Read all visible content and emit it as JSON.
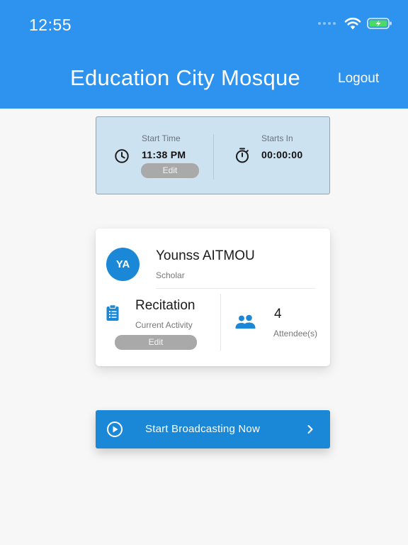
{
  "status_bar": {
    "time": "12:55"
  },
  "header": {
    "title": "Education City Mosque",
    "logout_label": "Logout"
  },
  "schedule": {
    "start_time_label": "Start Time",
    "start_time_value": "11:38 PM",
    "edit_label": "Edit",
    "starts_in_label": "Starts In",
    "starts_in_value": "00:00:00"
  },
  "scholar": {
    "initials": "YA",
    "name": "Younss AITMOU",
    "role": "Scholar",
    "activity_name": "Recitation",
    "activity_label": "Current Activity",
    "edit_label": "Edit",
    "attendee_count": "4",
    "attendee_label": "Attendee(s)"
  },
  "broadcast": {
    "label": "Start Broadcasting Now"
  },
  "colors": {
    "header": "#2e93ee",
    "accent": "#1a87d7",
    "battery": "#4cd964"
  },
  "icons": [
    "wifi-icon",
    "battery-icon",
    "clock-icon",
    "stopwatch-icon",
    "clipboard-icon",
    "people-icon",
    "play-circle-icon",
    "chevron-right-icon"
  ]
}
